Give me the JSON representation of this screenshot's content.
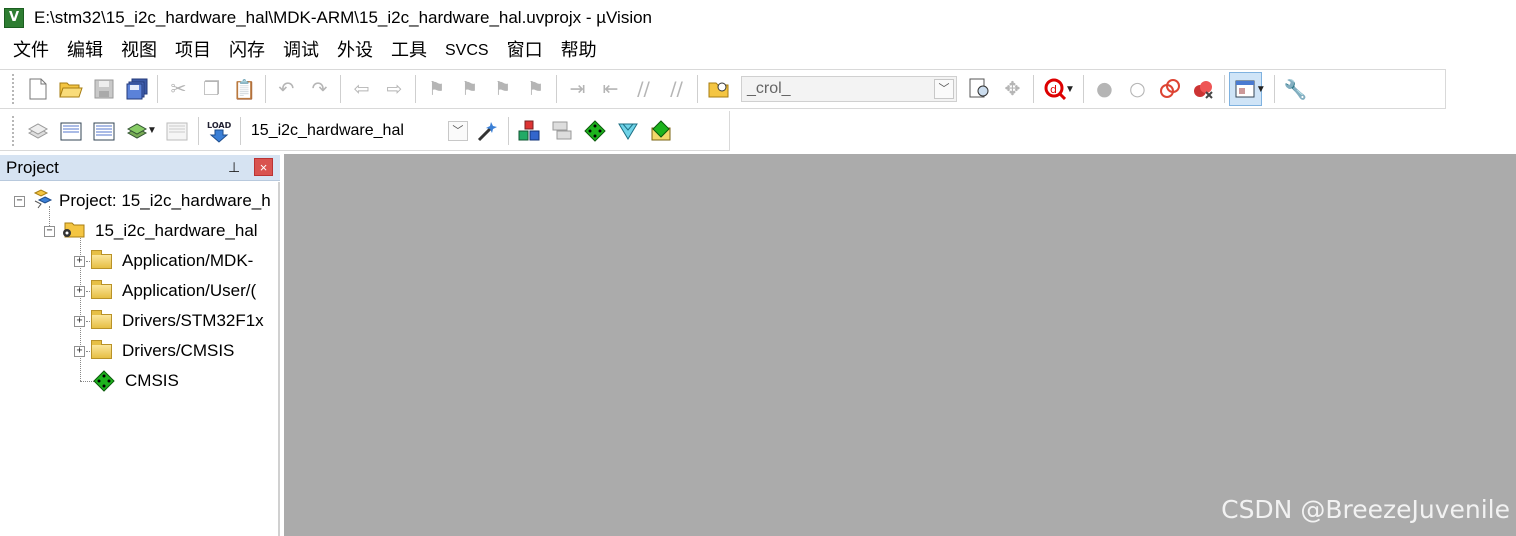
{
  "window": {
    "title": "E:\\stm32\\15_i2c_hardware_hal\\MDK-ARM\\15_i2c_hardware_hal.uvprojx - µVision",
    "icon_text": "V"
  },
  "menu": [
    "文件",
    "编辑",
    "视图",
    "项目",
    "闪存",
    "调试",
    "外设",
    "工具",
    "SVCS",
    "窗口",
    "帮助"
  ],
  "toolbar1": {
    "find_combo_value": "_crol_"
  },
  "toolbar2": {
    "load_label": "LOAD",
    "target_combo_value": "15_i2c_hardware_hal"
  },
  "project_panel": {
    "title": "Project",
    "pin_glyph": "⊥",
    "close_glyph": "×",
    "tree": {
      "root_label": "Project: 15_i2c_hardware_h",
      "target_label": "15_i2c_hardware_hal",
      "groups": [
        "Application/MDK-",
        "Application/User/(",
        "Drivers/STM32F1x",
        "Drivers/CMSIS"
      ],
      "component_label": "CMSIS"
    }
  },
  "editor": {
    "watermark": "CSDN @BreezeJuvenile"
  }
}
